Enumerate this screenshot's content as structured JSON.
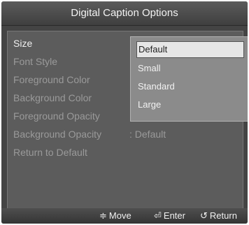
{
  "title": "Digital Caption Options",
  "menu": [
    {
      "label": "Size",
      "value": ""
    },
    {
      "label": "Font Style",
      "value": ""
    },
    {
      "label": "Foreground Color",
      "value": ""
    },
    {
      "label": "Background Color",
      "value": ""
    },
    {
      "label": "Foreground Opacity",
      "value": ""
    },
    {
      "label": "Background Opacity",
      "value": ": Default"
    },
    {
      "label": "Return to Default",
      "value": ""
    }
  ],
  "dropdown": {
    "options": [
      "Default",
      "Small",
      "Standard",
      "Large"
    ],
    "selected": "Default"
  },
  "hints": [
    {
      "icon": "≑",
      "label": "Move"
    },
    {
      "icon": "⏎",
      "label": "Enter"
    },
    {
      "icon": "↺",
      "label": "Return"
    }
  ]
}
